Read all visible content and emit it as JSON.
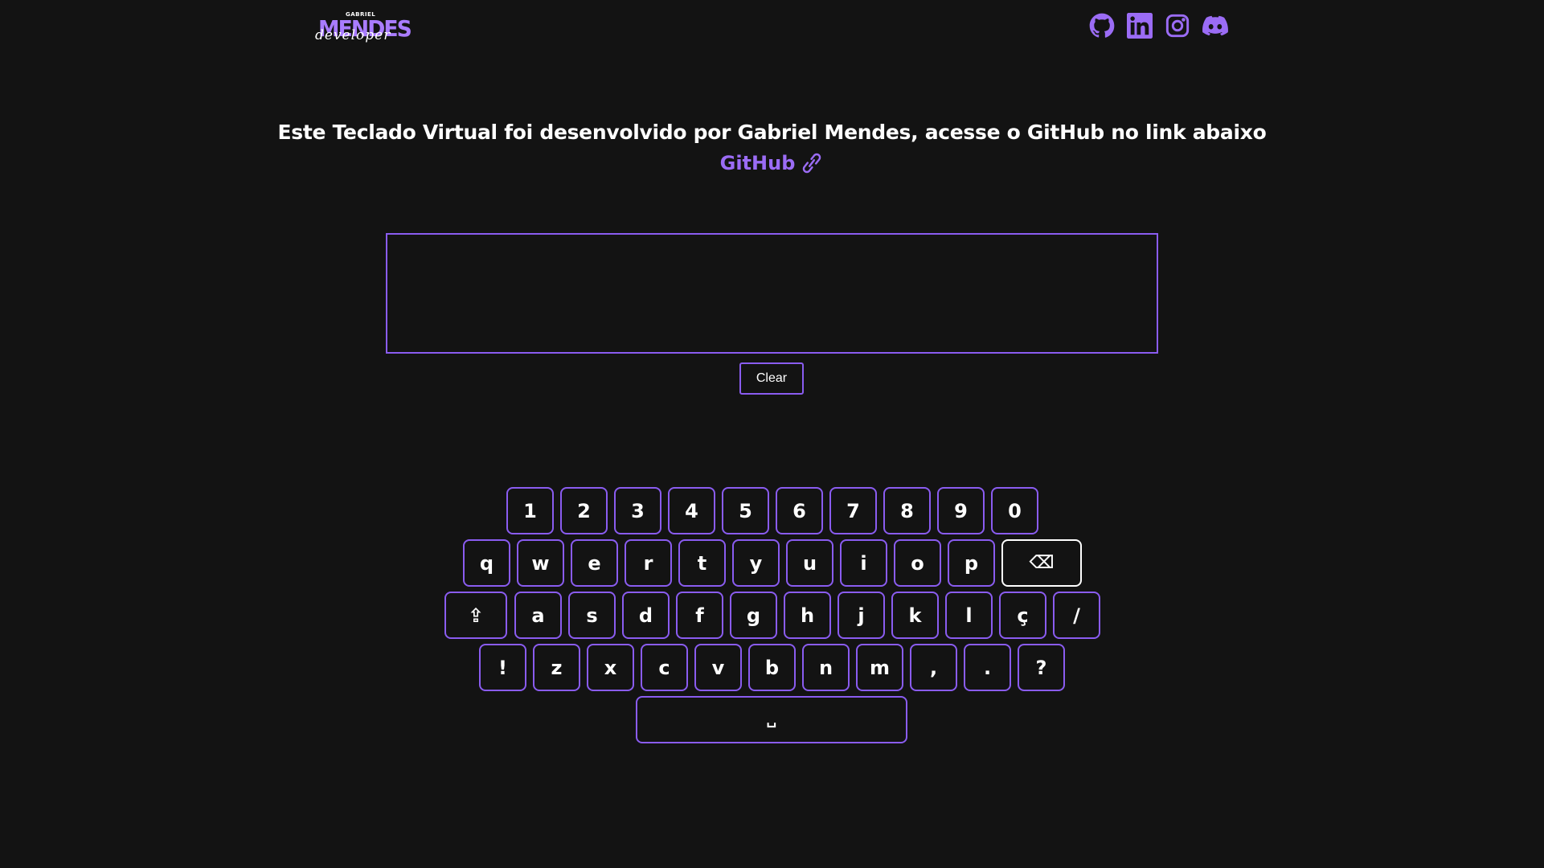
{
  "header": {
    "logo": {
      "small_text": "GABRIEL",
      "main_text": "MENDES",
      "script_text": "developer"
    },
    "socials": [
      {
        "name": "github-icon",
        "label": "GitHub"
      },
      {
        "name": "linkedin-icon",
        "label": "LinkedIn"
      },
      {
        "name": "instagram-icon",
        "label": "Instagram"
      },
      {
        "name": "discord-icon",
        "label": "Discord"
      }
    ]
  },
  "intro": {
    "text": "Este Teclado Virtual foi desenvolvido por Gabriel Mendes, acesse o GitHub no link abaixo",
    "link_label": "GitHub",
    "link_icon": "link-icon"
  },
  "editor": {
    "value": "",
    "clear_label": "Clear"
  },
  "keyboard": {
    "row_numbers": [
      "1",
      "2",
      "3",
      "4",
      "5",
      "6",
      "7",
      "8",
      "9",
      "0"
    ],
    "row_top": [
      "q",
      "w",
      "e",
      "r",
      "t",
      "y",
      "u",
      "i",
      "o",
      "p"
    ],
    "backspace": "⌫",
    "shift": "⇪",
    "row_home": [
      "a",
      "s",
      "d",
      "f",
      "g",
      "h",
      "j",
      "k",
      "l",
      "ç"
    ],
    "slash": "/",
    "row_bottom": [
      "!",
      "z",
      "x",
      "c",
      "v",
      "b",
      "n",
      "m",
      ",",
      ".",
      "?"
    ],
    "space": "␣"
  },
  "colors": {
    "background": "#131313",
    "accent": "#8a5cf0",
    "link": "#9b6cf5",
    "text": "#ffffff"
  }
}
